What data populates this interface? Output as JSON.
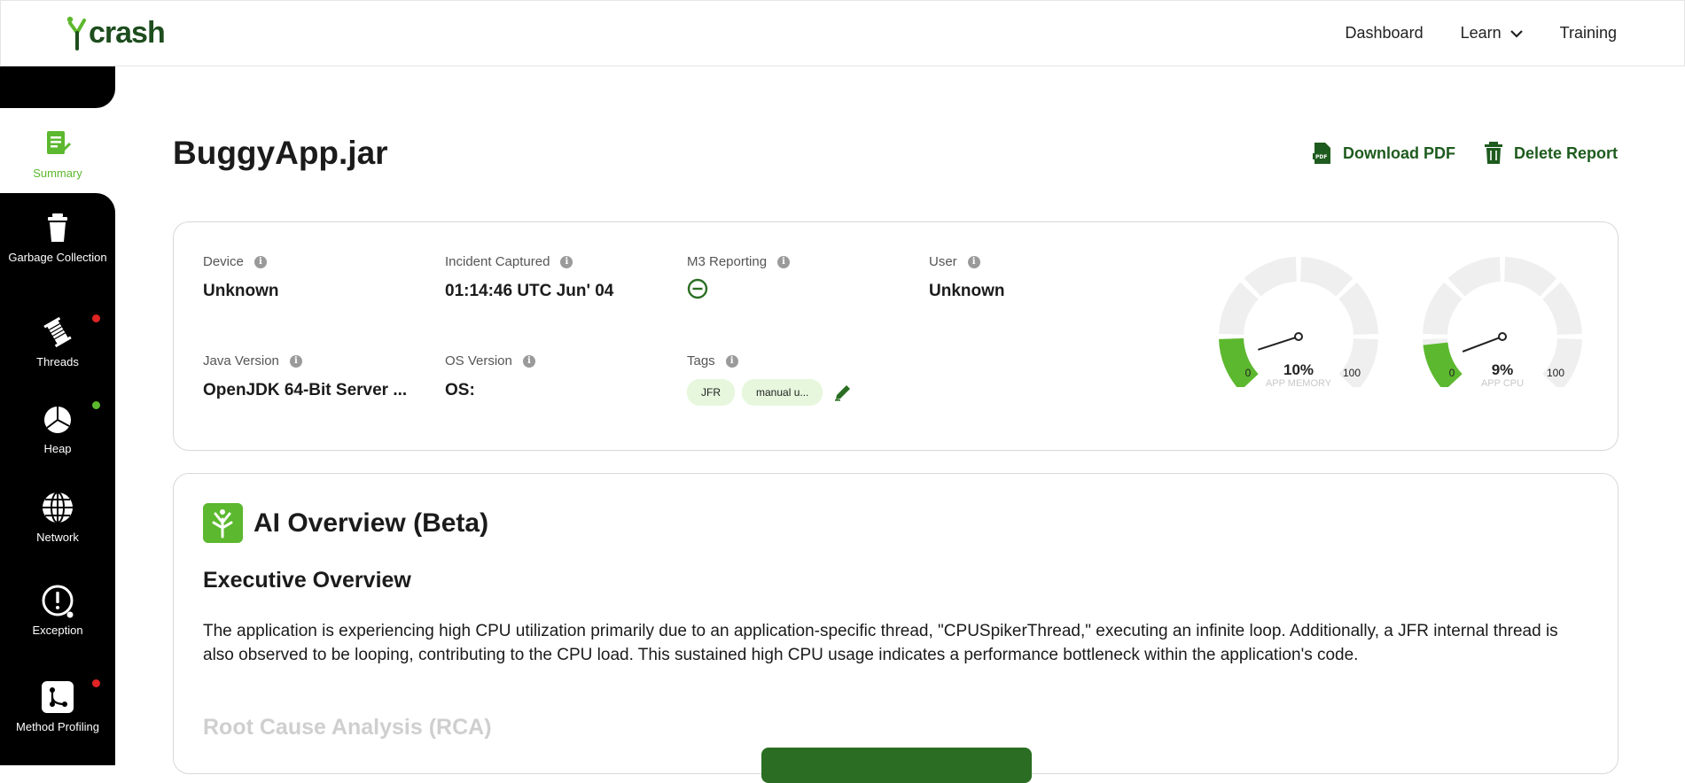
{
  "brand": {
    "name": "crash",
    "color": "#5cb82e",
    "dark": "#1e4d1e"
  },
  "nav": {
    "items": [
      {
        "label": "Dashboard"
      },
      {
        "label": "Learn"
      },
      {
        "label": "Training"
      }
    ]
  },
  "sidebar": {
    "items": [
      {
        "label": "Summary",
        "icon": "summary-icon",
        "active": true
      },
      {
        "label": "Garbage Collection",
        "icon": "trash-icon"
      },
      {
        "label": "Threads",
        "icon": "thread-spool-icon",
        "dot": "#e02424"
      },
      {
        "label": "Heap",
        "icon": "pie-chart-icon",
        "dot": "#5cb82e"
      },
      {
        "label": "Network",
        "icon": "globe-icon"
      },
      {
        "label": "Exception",
        "icon": "exclamation-icon"
      },
      {
        "label": "Method Profiling",
        "icon": "profiling-icon",
        "dot": "#e02424"
      }
    ]
  },
  "page": {
    "title": "BuggyApp.jar",
    "download_pdf": "Download PDF",
    "delete_report": "Delete Report"
  },
  "details": {
    "device": {
      "label": "Device",
      "value": "Unknown"
    },
    "incident": {
      "label": "Incident Captured",
      "value": "01:14:46 UTC Jun' 04"
    },
    "m3": {
      "label": "M3 Reporting"
    },
    "user": {
      "label": "User",
      "value": "Unknown"
    },
    "java": {
      "label": "Java Version",
      "value": "OpenJDK 64-Bit Server ..."
    },
    "os": {
      "label": "OS Version",
      "value": "OS:"
    },
    "tags": {
      "label": "Tags",
      "items": [
        "JFR",
        "manual u..."
      ]
    }
  },
  "gauges": [
    {
      "value": "10%",
      "fraction": 0.1,
      "min": "0",
      "max": "100",
      "label": "APP MEMORY"
    },
    {
      "value": "9%",
      "fraction": 0.09,
      "min": "0",
      "max": "100",
      "label": "APP CPU"
    }
  ],
  "ai": {
    "title": "AI Overview (Beta)",
    "exec_heading": "Executive Overview",
    "summary": "The application is experiencing high CPU utilization primarily due to an application-specific thread, \"CPUSpikerThread,\" executing an infinite loop. Additionally, a JFR internal thread is also observed to be looping, contributing to the CPU load. This sustained high CPU usage indicates a performance bottleneck within the application's code.",
    "rca_heading": "Root Cause Analysis (RCA)"
  }
}
